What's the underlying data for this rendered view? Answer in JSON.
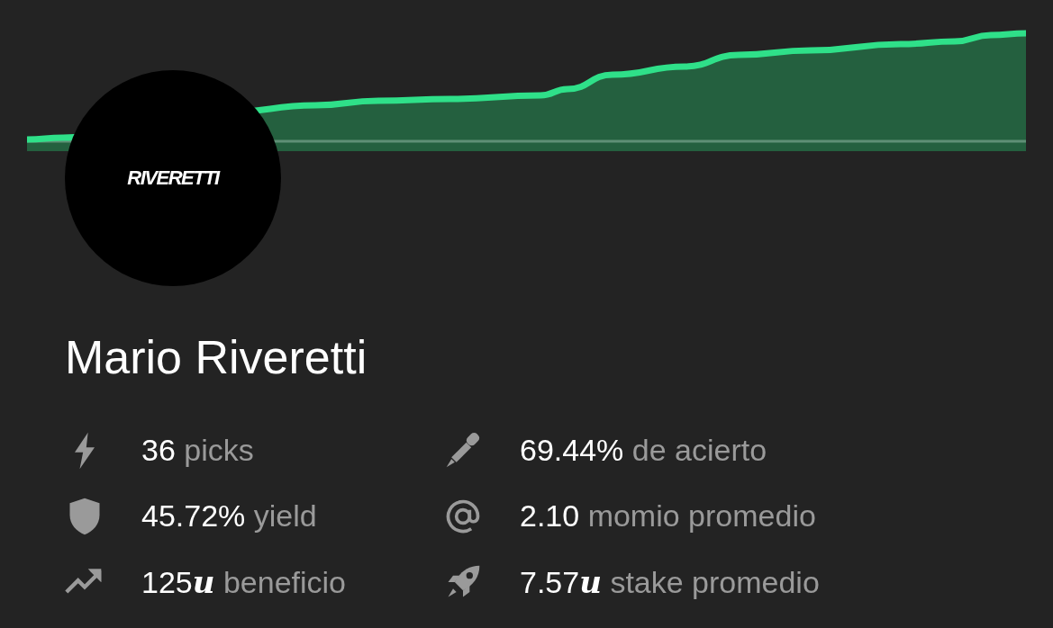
{
  "profile": {
    "avatar_text": "RIVERETTI",
    "name": "Mario Riveretti"
  },
  "stats": [
    {
      "kind": "bolt",
      "value": "36",
      "label": "picks"
    },
    {
      "kind": "dart",
      "value": "69.44%",
      "label": "de acierto"
    },
    {
      "kind": "shield",
      "value": "45.72%",
      "label": "yield"
    },
    {
      "kind": "at",
      "value": "2.10",
      "label": "momio promedio"
    },
    {
      "kind": "trend",
      "value": "125",
      "unit": "u",
      "label": "beneficio"
    },
    {
      "kind": "rocket",
      "value": "7.57",
      "unit": "u",
      "label": "stake promedio"
    }
  ]
}
